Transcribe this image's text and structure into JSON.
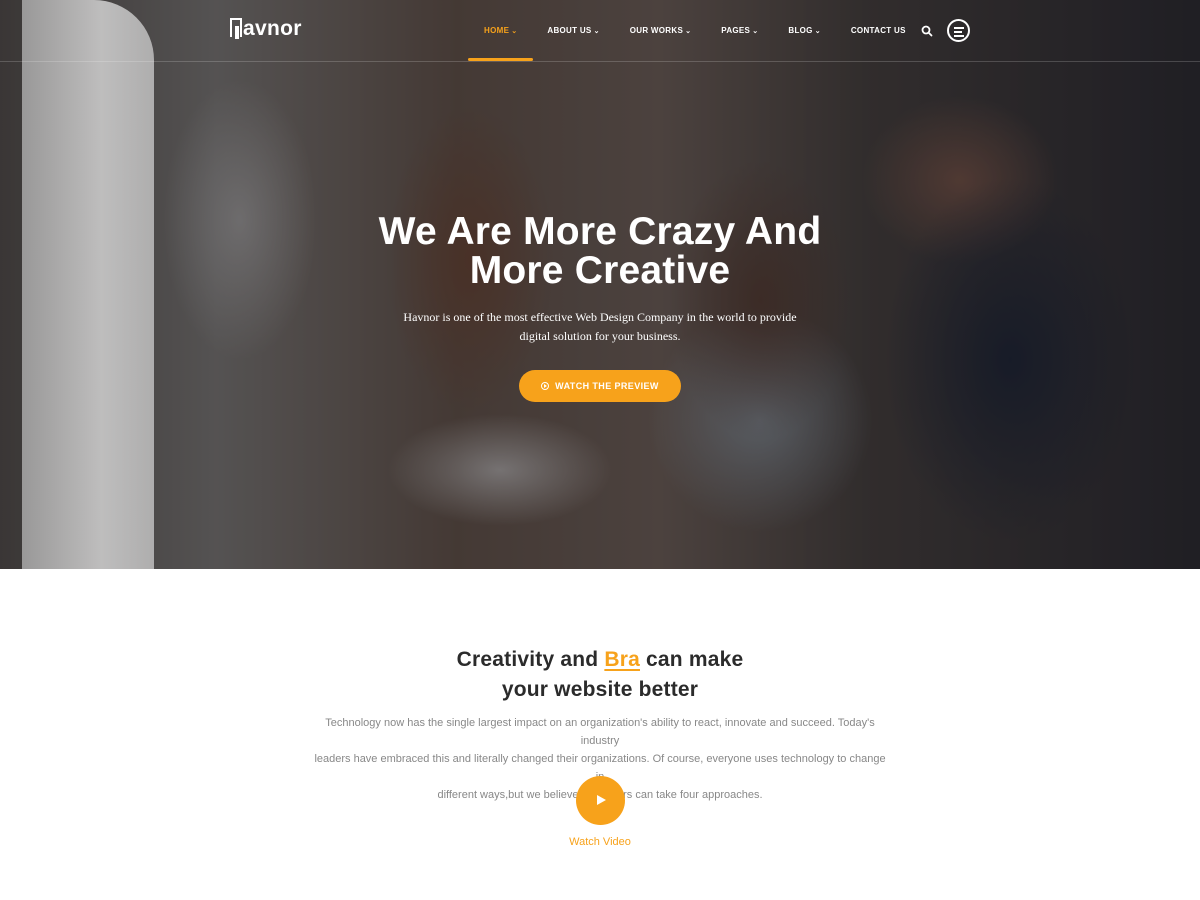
{
  "brand": {
    "name": "avnor",
    "accent": "#f7a21b"
  },
  "nav": {
    "items": [
      {
        "label": "HOME",
        "active": true,
        "has_dropdown": true
      },
      {
        "label": "ABOUT US",
        "active": false,
        "has_dropdown": true
      },
      {
        "label": "OUR WORKS",
        "active": false,
        "has_dropdown": true
      },
      {
        "label": "PAGES",
        "active": false,
        "has_dropdown": true
      },
      {
        "label": "BLOG",
        "active": false,
        "has_dropdown": true
      },
      {
        "label": "CONTACT US",
        "active": false,
        "has_dropdown": false
      }
    ],
    "search_icon": "search-icon",
    "menu_icon": "hamburger-menu-icon",
    "chevron": "⌄"
  },
  "hero": {
    "title_line1": "We Are More Crazy And",
    "title_line2": "More Creative",
    "subtitle_line1": "Havnor is one of the most effective Web Design Company in the world to provide",
    "subtitle_line2": "digital solution for your business.",
    "cta_label": "WATCH THE PREVIEW"
  },
  "about": {
    "heading_part1": "Creativity and ",
    "heading_accent": "Bra",
    "heading_part2": " can make",
    "heading_line2": "your website better",
    "text_line1": "Technology now has the single largest impact on an organization's ability to react, innovate and succeed. Today's industry",
    "text_line2": "leaders have embraced this and literally changed their organizations. Of course, everyone uses technology to change in",
    "text_line3": "different ways,but we believe customers can take four approaches.",
    "video_label": "Watch Video"
  }
}
